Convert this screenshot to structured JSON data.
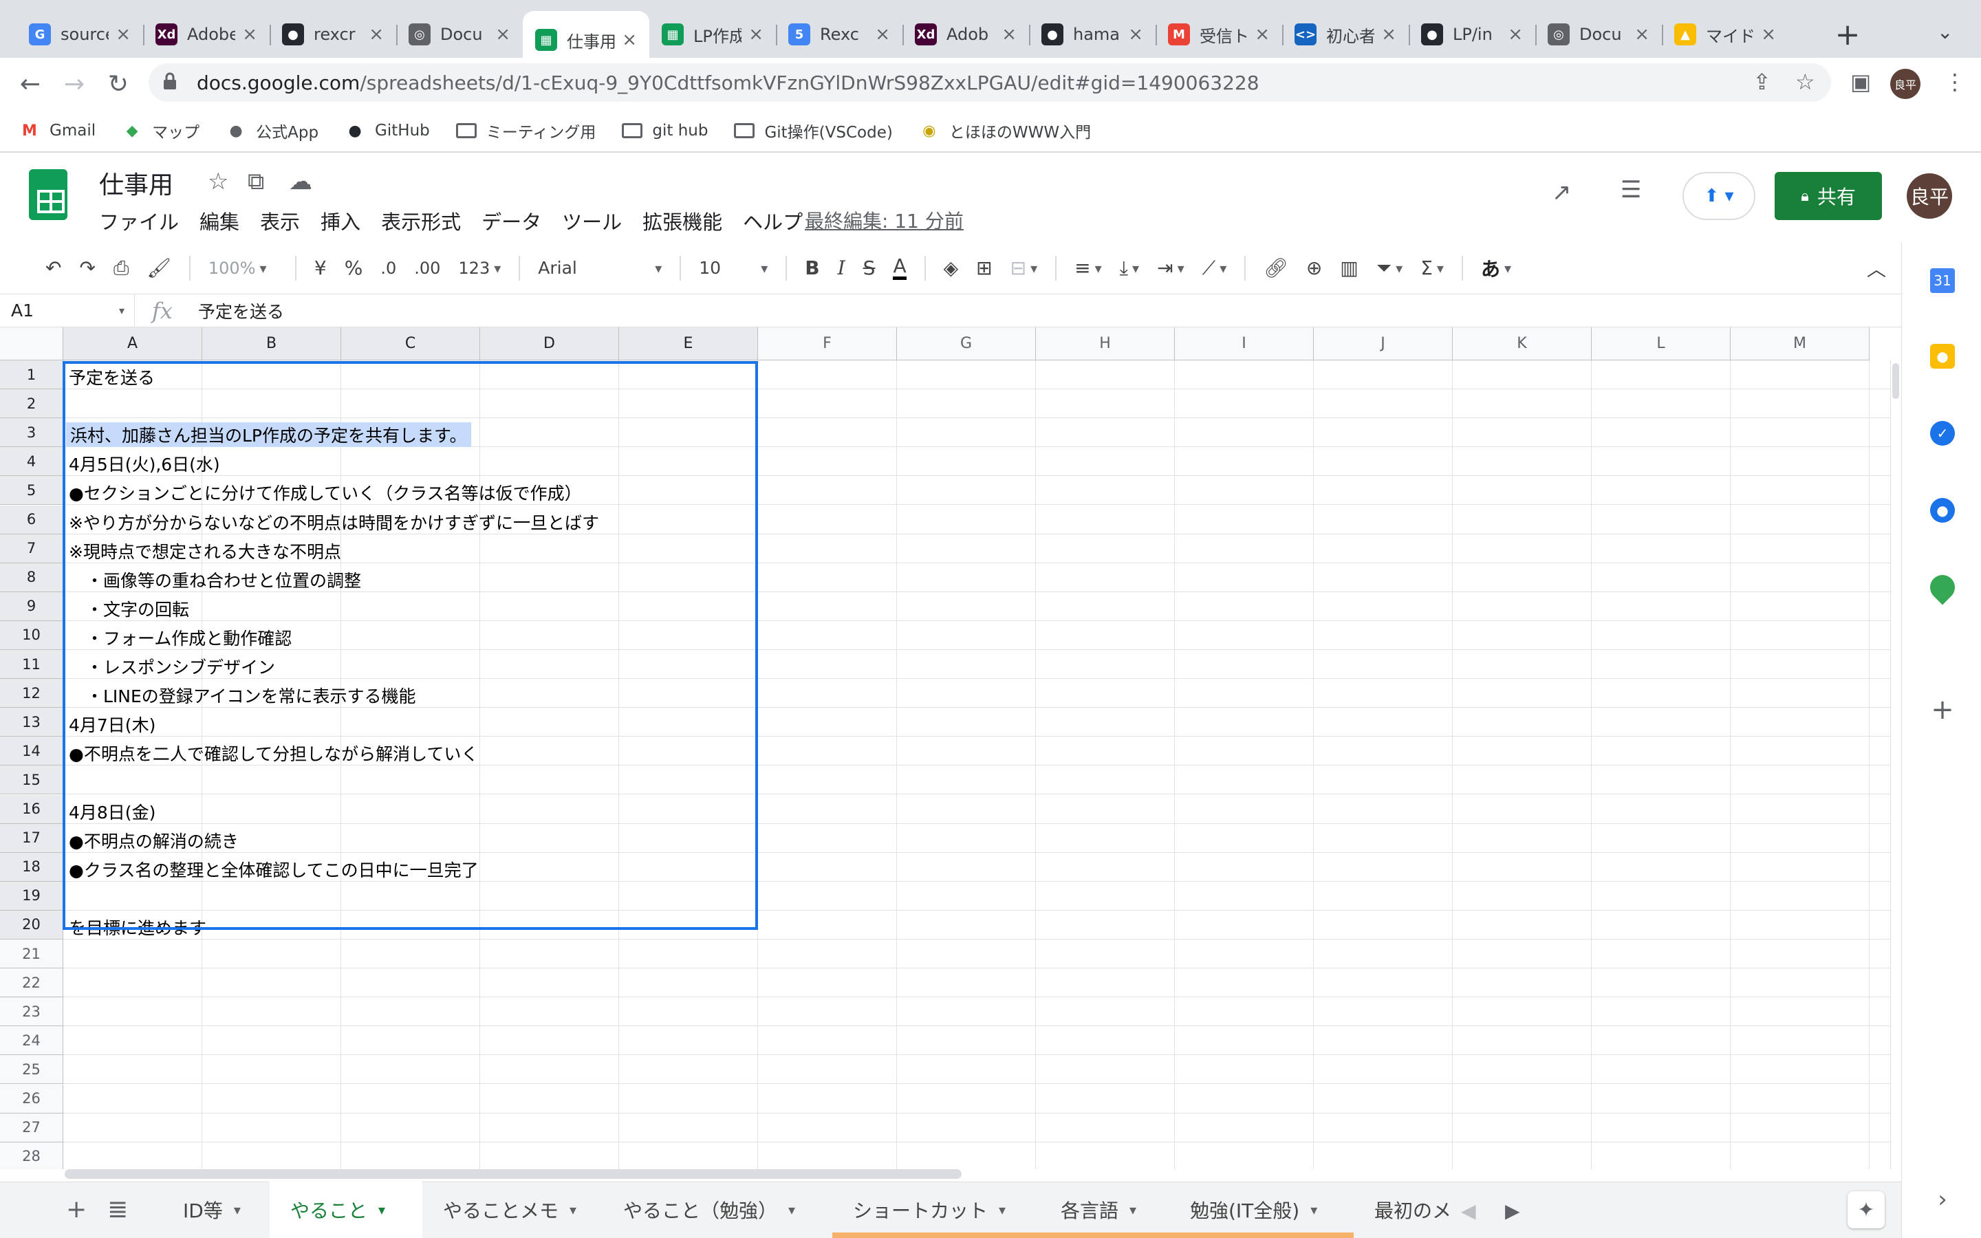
{
  "browser": {
    "tabs": [
      {
        "title": "source",
        "fav": "G",
        "color": "#4285f4"
      },
      {
        "title": "Adobe",
        "fav": "Xd",
        "color": "#470137"
      },
      {
        "title": "rexcr",
        "fav": "●",
        "color": "#24292f"
      },
      {
        "title": "Docu",
        "fav": "◎",
        "color": "#5f6368"
      },
      {
        "title": "仕事用",
        "fav": "▦",
        "color": "#0f9d58"
      },
      {
        "title": "LP作成",
        "fav": "▦",
        "color": "#0f9d58"
      },
      {
        "title": "Rexc",
        "fav": "5",
        "color": "#4285f4"
      },
      {
        "title": "Adob",
        "fav": "Xd",
        "color": "#470137"
      },
      {
        "title": "hama",
        "fav": "●",
        "color": "#24292f"
      },
      {
        "title": "受信トレイ",
        "fav": "M",
        "color": "#ea4335"
      },
      {
        "title": "初心者",
        "fav": "<>",
        "color": "#1565c0"
      },
      {
        "title": "LP/in",
        "fav": "●",
        "color": "#24292f"
      },
      {
        "title": "Docu",
        "fav": "◎",
        "color": "#5f6368"
      },
      {
        "title": "マイドライブ",
        "fav": "▲",
        "color": "#fbbc04"
      }
    ],
    "url_host": "docs.google.com",
    "url_path": "/spreadsheets/d/1-cExuq-9_9Y0CdttfsomkVFznGYlDnWrS98ZxxLPGAU/edit#gid=1490063228",
    "profile_initials": "良平",
    "bookmarks": [
      "Gmail",
      "マップ",
      "公式App",
      "GitHub",
      "ミーティング用",
      "git hub",
      "Git操作(VSCode)",
      "とほほのWWW入門"
    ]
  },
  "doc": {
    "title": "仕事用",
    "menu": [
      "ファイル",
      "編集",
      "表示",
      "挿入",
      "表示形式",
      "データ",
      "ツール",
      "拡張機能",
      "ヘルプ"
    ],
    "last_edit": "最終編集: 11 分前",
    "share_label": "共有",
    "user_initials": "良平"
  },
  "toolbar": {
    "zoom": "100%",
    "currency": "¥",
    "percent": "%",
    "dec_less": ".0",
    "dec_more": ".00",
    "format_more": "123",
    "font": "Arial",
    "font_size": "10",
    "input_tools": "あ"
  },
  "formula": {
    "cell_ref": "A1",
    "fx": "fx",
    "content": "予定を送る"
  },
  "columns": [
    "A",
    "B",
    "C",
    "D",
    "E",
    "F",
    "G",
    "H",
    "I",
    "J",
    "K",
    "L",
    "M"
  ],
  "rows": [
    "1",
    "2",
    "3",
    "4",
    "5",
    "6",
    "7",
    "8",
    "9",
    "10",
    "11",
    "12",
    "13",
    "14",
    "15",
    "16",
    "17",
    "18",
    "19",
    "20",
    "21",
    "22",
    "23",
    "24",
    "25",
    "26",
    "27",
    "28"
  ],
  "cells": {
    "r1": "予定を送る",
    "r2": "",
    "r3": "浜村、加藤さん担当のLP作成の予定を共有します。",
    "r4": "4月5日(火),6日(水)",
    "r5": "●セクションごとに分けて作成していく（クラス名等は仮で作成）",
    "r6": "※やり方が分からないなどの不明点は時間をかけすぎずに一旦とばす",
    "r7": "※現時点で想定される大きな不明点",
    "r8": "　・画像等の重ね合わせと位置の調整",
    "r9": "　・文字の回転",
    "r10": "　・フォーム作成と動作確認",
    "r11": "　・レスポンシブデザイン",
    "r12": "　・LINEの登録アイコンを常に表示する機能",
    "r13": "4月7日(木)",
    "r14": "●不明点を二人で確認して分担しながら解消していく",
    "r16": "4月8日(金)",
    "r17": "●不明点の解消の続き",
    "r18": "●クラス名の整理と全体確認してこの日中に一旦完了",
    "r20": "を目標に進めます"
  },
  "sheets": [
    {
      "label": "ID等",
      "accent": ""
    },
    {
      "label": "やること",
      "accent": ""
    },
    {
      "label": "やることメモ",
      "accent": ""
    },
    {
      "label": "やること（勉強）",
      "accent": ""
    },
    {
      "label": "ショートカット",
      "accent": "#f6b26b"
    },
    {
      "label": "各言語",
      "accent": "#f6b26b"
    },
    {
      "label": "勉強(IT全般)",
      "accent": "#f6b26b"
    },
    {
      "label": "最初のメ",
      "accent": ""
    }
  ],
  "colors": {
    "accent": "#1a73e8",
    "share_green": "#188038",
    "highlight": "#c6dafc"
  }
}
